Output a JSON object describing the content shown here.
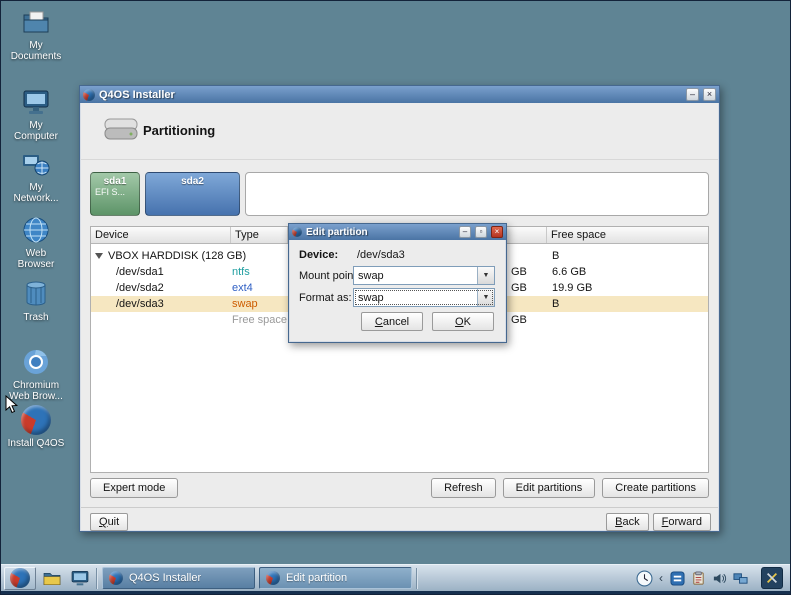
{
  "glyphs": {
    "minimize": "–",
    "maximize": "▫",
    "close": "×",
    "dropdown": "▼",
    "collapse": "‹"
  },
  "colors": {
    "desktop": "#5f8494",
    "titlebar": "#4a74a4",
    "highlight_row": "#f6e7c1",
    "ntfs": "#1f9ea0",
    "ext4": "#2f5fc4",
    "swap": "#cd5c00",
    "partition_sda1": "#6f9e76",
    "partition_sda2": "#5a83bd"
  },
  "desktop": {
    "icons": [
      {
        "label": "My Documents"
      },
      {
        "label": "My Computer"
      },
      {
        "label": "My Network..."
      },
      {
        "label": "Web Browser"
      },
      {
        "label": "Trash"
      },
      {
        "label": "Chromium Web Brow..."
      },
      {
        "label": "Install Q4OS"
      }
    ]
  },
  "installer": {
    "title": "Q4OS Installer",
    "heading": "Partitioning",
    "partitions": [
      {
        "name": "sda1",
        "sub": "EFI S..."
      },
      {
        "name": "sda2",
        "sub": ""
      }
    ],
    "table": {
      "headers": {
        "device": "Device",
        "type": "Type",
        "mid": "",
        "free": "Free space"
      },
      "rows": [
        {
          "device": "VBOX HARDDISK (128 GB)",
          "type": "",
          "mid": "",
          "free": "B"
        },
        {
          "device": "/dev/sda1",
          "type": "ntfs",
          "mid": "GB",
          "free": "6.6 GB"
        },
        {
          "device": "/dev/sda2",
          "type": "ext4",
          "mid": "GB",
          "free": "19.9 GB"
        },
        {
          "device": "/dev/sda3",
          "type": "swap",
          "mid": "",
          "free": "B"
        },
        {
          "device": "",
          "type": "Free space",
          "mid": "GB",
          "free": ""
        }
      ]
    },
    "buttons": {
      "expert": "Expert mode",
      "refresh": "Refresh",
      "edit": "Edit partitions",
      "create": "Create partitions"
    },
    "footer": {
      "quit": {
        "accel": "Q",
        "rest": "uit"
      },
      "back": {
        "accel": "B",
        "rest": "ack"
      },
      "forward": {
        "accel": "F",
        "rest": "orward"
      }
    }
  },
  "dialog": {
    "title": "Edit partition",
    "device_label": "Device:",
    "device_value": "/dev/sda3",
    "mount_label": "Mount point:",
    "mount_value": "swap",
    "format_label": "Format as:",
    "format_value": "swap",
    "cancel": {
      "accel": "C",
      "rest": "ancel"
    },
    "ok": {
      "accel": "O",
      "rest": "K"
    }
  },
  "taskbar": {
    "tasks": [
      {
        "label": "Q4OS Installer"
      },
      {
        "label": "Edit partition"
      }
    ]
  }
}
